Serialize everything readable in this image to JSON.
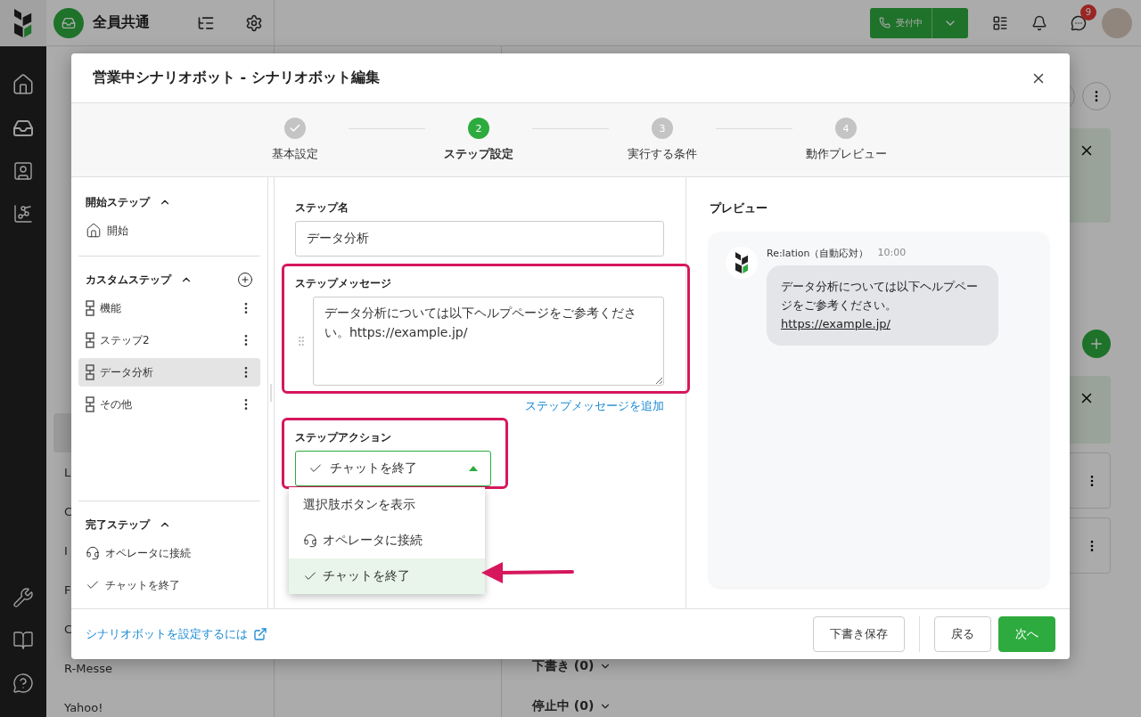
{
  "topbar": {
    "workspace": "全員共通",
    "status_button": "受付中",
    "notification_count": "9"
  },
  "background_list": [
    {
      "selected": true
    },
    {
      "text": "L",
      "selected": false
    },
    {
      "text": "C",
      "selected": false
    },
    {
      "text": "I",
      "selected": false
    },
    {
      "text": "F",
      "selected": false
    },
    {
      "text": "C",
      "selected": false
    },
    {
      "text": "R-Messe",
      "selected": false
    },
    {
      "text": "Yahoo!",
      "selected": false
    }
  ],
  "background_sections": [
    "下書き (0)",
    "停止中 (0)"
  ],
  "modal": {
    "title": "営業中シナリオボット - シナリオボット編集",
    "steps": [
      {
        "label": "基本設定",
        "done": true,
        "selected": false
      },
      {
        "label": "ステップ設定",
        "number": "2",
        "done": false,
        "selected": true
      },
      {
        "label": "実行する条件",
        "number": "3",
        "done": false,
        "selected": false
      },
      {
        "label": "動作プレビュー",
        "number": "4",
        "done": false,
        "selected": false
      }
    ],
    "step_panel": {
      "start": {
        "heading": "開始ステップ",
        "items": [
          {
            "label": "開始",
            "kind": "home"
          }
        ]
      },
      "custom": {
        "heading": "カスタムステップ",
        "items": [
          {
            "label": "機能",
            "selected": false
          },
          {
            "label": "ステップ2",
            "selected": false
          },
          {
            "label": "データ分析",
            "selected": true
          },
          {
            "label": "その他",
            "selected": false
          }
        ]
      },
      "end": {
        "heading": "完了ステップ",
        "items": [
          {
            "label": "オペレータに接続",
            "kind": "operator"
          },
          {
            "label": "チャットを終了",
            "kind": "check"
          }
        ]
      }
    },
    "form": {
      "name_label": "ステップ名",
      "name_value": "データ分析",
      "message_label": "ステップメッセージ",
      "message_value": "データ分析については以下ヘルプページをご参考ください。https://example.jp/",
      "add_message_link": "ステップメッセージを追加",
      "action_label": "ステップアクション",
      "action_value": "チャットを終了",
      "action_options": [
        {
          "label": "選択肢ボタンを表示",
          "kind": "plain",
          "selected": false
        },
        {
          "label": "オペレータに接続",
          "kind": "operator",
          "selected": false
        },
        {
          "label": "チャットを終了",
          "kind": "check",
          "selected": true
        }
      ]
    },
    "preview": {
      "title": "プレビュー",
      "sender": "Re:lation（自動応対）",
      "time": "10:00",
      "message": "データ分析については以下ヘルプページをご参考ください。",
      "link": "https://example.jp/"
    },
    "footer": {
      "help_link": "シナリオボットを設定するには",
      "draft_button": "下書き保存",
      "back_button": "戻る",
      "next_button": "次へ"
    }
  }
}
